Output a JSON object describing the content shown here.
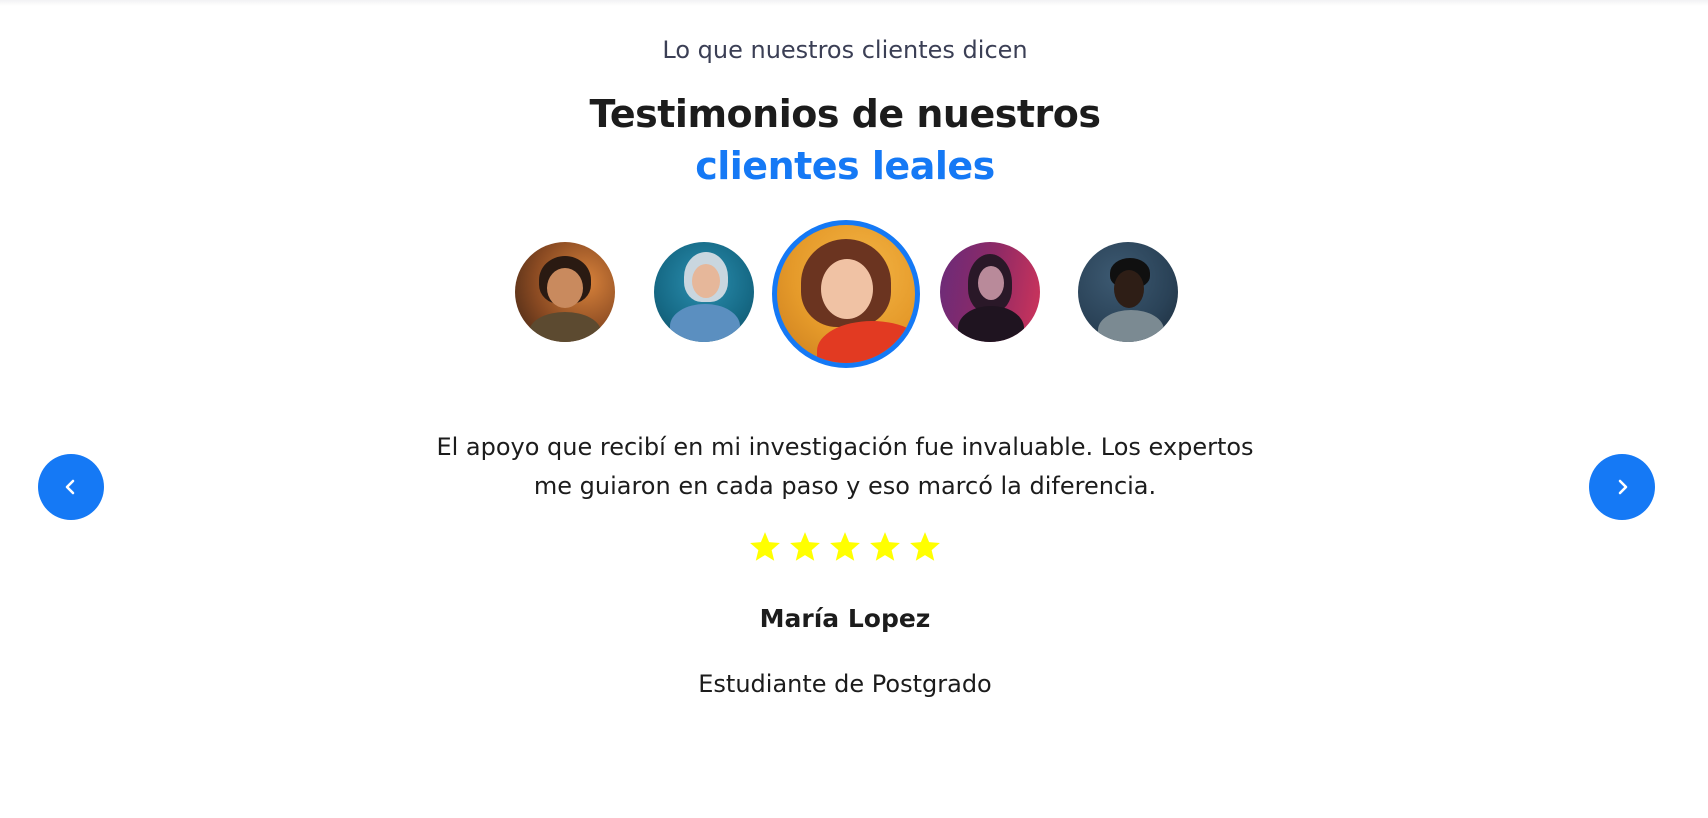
{
  "section": {
    "eyebrow": "Lo que nuestros clientes dicen",
    "title_line1": "Testimonios de nuestros",
    "title_line2": "clientes leales",
    "accent_color": "#1579f5",
    "title_color": "#1c1c1c"
  },
  "avatars": [
    {
      "name": "avatar-1",
      "active": false
    },
    {
      "name": "avatar-2",
      "active": false
    },
    {
      "name": "avatar-3",
      "active": true
    },
    {
      "name": "avatar-4",
      "active": false
    },
    {
      "name": "avatar-5",
      "active": false
    }
  ],
  "navigation": {
    "prev_icon": "chevron-left-icon",
    "next_icon": "chevron-right-icon",
    "button_color": "#1579f5"
  },
  "testimonial": {
    "quote_line1": "El apoyo que recibí en mi investigación fue invaluable. Los expertos",
    "quote_line2": "me guiaron en cada paso y eso marcó la diferencia.",
    "rating": 5,
    "rating_max": 5,
    "star_color": "#ffff00",
    "author_name": "María Lopez",
    "author_role": "Estudiante de Postgrado"
  }
}
